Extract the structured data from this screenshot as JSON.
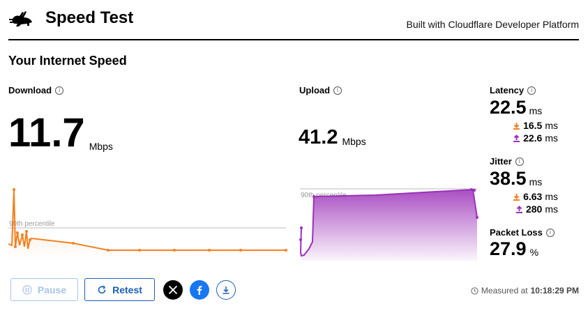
{
  "header": {
    "title": "Speed Test",
    "built_with": "Built with Cloudflare Developer Platform"
  },
  "section_title": "Your Internet Speed",
  "download": {
    "label": "Download",
    "value": "11.7",
    "unit": "Mbps",
    "percentile_label": "90th percentile",
    "color": "#f38020"
  },
  "upload": {
    "label": "Upload",
    "value": "41.2",
    "unit": "Mbps",
    "percentile_label": "90th percentile",
    "color": "#9b30b8"
  },
  "latency": {
    "label": "Latency",
    "value": "22.5",
    "unit": "ms",
    "down_value": "16.5",
    "up_value": "22.6",
    "sub_unit": "ms"
  },
  "jitter": {
    "label": "Jitter",
    "value": "38.5",
    "unit": "ms",
    "down_value": "6.63",
    "up_value": "280",
    "sub_unit": "ms"
  },
  "packet_loss": {
    "label": "Packet Loss",
    "value": "27.9",
    "unit": "%"
  },
  "buttons": {
    "pause": "Pause",
    "retest": "Retest"
  },
  "footer": {
    "measured_prefix": "Measured at",
    "measured_time": "10:18:29 PM"
  },
  "icons": {
    "logo": "rabbit-icon",
    "info": "info-icon",
    "pause": "pause-icon",
    "retest": "refresh-icon",
    "x": "x-logo-icon",
    "facebook": "facebook-icon",
    "download": "download-icon",
    "clock": "clock-icon"
  },
  "colors": {
    "accent": "#1a5fb4",
    "download": "#f38020",
    "upload": "#9b30b8"
  }
}
